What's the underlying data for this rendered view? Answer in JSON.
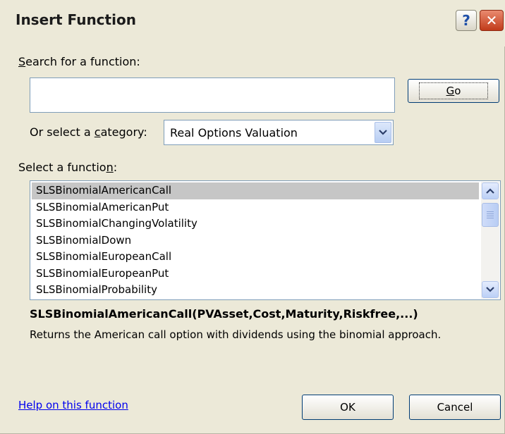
{
  "window": {
    "title": "Insert Function",
    "help_glyph": "?",
    "close_glyph": "✕"
  },
  "search": {
    "label": "Search for a function:",
    "label_underline": "S",
    "label_rest": "earch for a function:",
    "value": "",
    "go_label_underline": "G",
    "go_label_rest": "o"
  },
  "category": {
    "label_before": "Or select a ",
    "label_underline": "c",
    "label_after": "ategory:",
    "selected": "Real Options Valuation"
  },
  "functions": {
    "label_before": "Select a functio",
    "label_underline": "n",
    "label_after": ":",
    "items": [
      "SLSBinomialAmericanCall",
      "SLSBinomialAmericanPut",
      "SLSBinomialChangingVolatility",
      "SLSBinomialDown",
      "SLSBinomialEuropeanCall",
      "SLSBinomialEuropeanPut",
      "SLSBinomialProbability"
    ],
    "selected_index": 0
  },
  "details": {
    "signature": "SLSBinomialAmericanCall(PVAsset,Cost,Maturity,Riskfree,...)",
    "description": "Returns the American call option with dividends using the binomial approach."
  },
  "footer": {
    "help_link": "Help on this function",
    "ok_label": "OK",
    "cancel_label": "Cancel"
  },
  "icons": {
    "dropdown": "chevron-down-icon",
    "scroll_up": "chevron-up-icon",
    "scroll_down": "chevron-down-icon"
  },
  "colors": {
    "dialog_bg": "#ece9d8",
    "selection": "#c6c6c6",
    "link": "#0000ee",
    "close": "#c13b1a"
  }
}
